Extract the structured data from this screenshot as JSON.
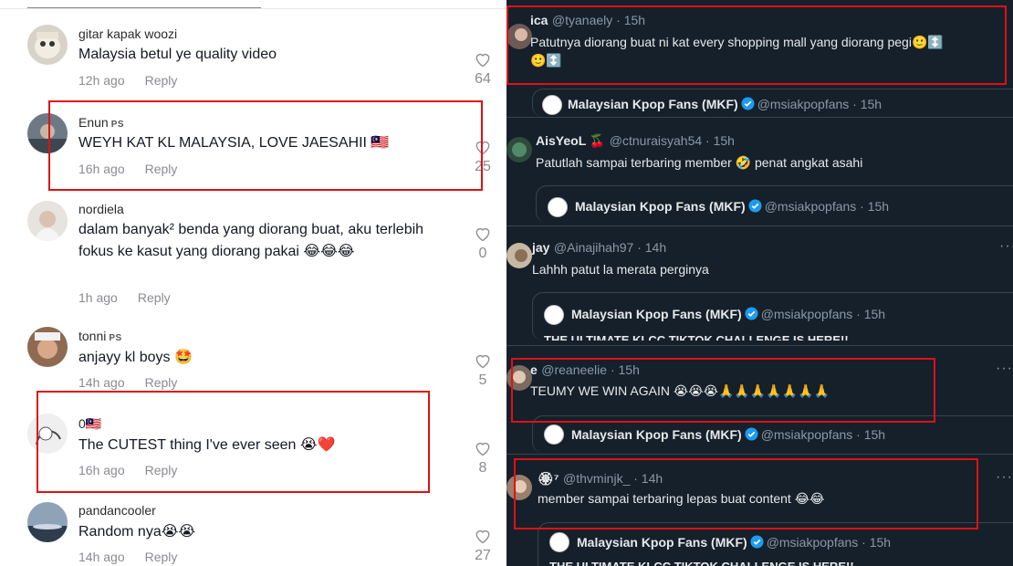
{
  "tiktok": {
    "comments": [
      {
        "user": "gitar kapak woozi",
        "tag": "",
        "text": "Malaysia betul ye quality video",
        "time": "12h ago",
        "reply": "Reply",
        "likes": "64"
      },
      {
        "user": "Enun",
        "tag": "PS",
        "text": "WEYH KAT KL MALAYSIA, LOVE JAESAHII 🇲🇾",
        "time": "16h ago",
        "reply": "Reply",
        "likes": "25"
      },
      {
        "user": "nordiela",
        "tag": "",
        "text": "dalam banyak² benda yang diorang buat, aku terlebih fokus ke kasut yang diorang pakai 😂😂😂",
        "time": "1h ago",
        "reply": "Reply",
        "likes": "0"
      },
      {
        "user": "tonni",
        "tag": "PS",
        "text": "anjayy kl boys 🤩",
        "time": "14h ago",
        "reply": "Reply",
        "likes": "5"
      },
      {
        "user": "0🇲🇾",
        "tag": "",
        "text": "The CUTEST thing I've ever seen 😭❤️",
        "time": "16h ago",
        "reply": "Reply",
        "likes": "8"
      },
      {
        "user": "pandancooler",
        "tag": "",
        "text": "Random nya😭😭",
        "time": "14h ago",
        "reply": "Reply",
        "likes": "27"
      }
    ]
  },
  "twitter": {
    "quote_name": "Malaysian Kpop Fans (MKF)",
    "quote_handle": "@msiakpopfans · 15h",
    "quote_preview": "THE ULTIMATE KLCC TIKTOK CHALLENGE IS HERE!!",
    "tweets": [
      {
        "name": "ica",
        "handle": "@tyanaely · 15h",
        "text": "Patutnya diorang buat ni kat every shopping mall yang diorang pegi🙂↕️",
        "text2": "🙂↕️"
      },
      {
        "name": "AisYeoL 🍒",
        "handle": "@ctnuraisyah54 · 15h",
        "text": "Patutlah sampai terbaring member 🤣 penat angkat asahi"
      },
      {
        "name": "jay",
        "handle": "@Ainajihah97 · 14h",
        "text": "Lahhh patut la merata perginya"
      },
      {
        "name": "e",
        "handle": "@reaneelie · 15h",
        "text": "TEUMY WE WIN AGAIN 😭😭😭🙏🙏🙏🙏🙏🙏🙏"
      },
      {
        "name": "🏵⁷",
        "handle": "@thvminjk_ · 14h",
        "text": "member sampai terbaring lepas buat content 😂😂"
      }
    ],
    "more": "···"
  }
}
